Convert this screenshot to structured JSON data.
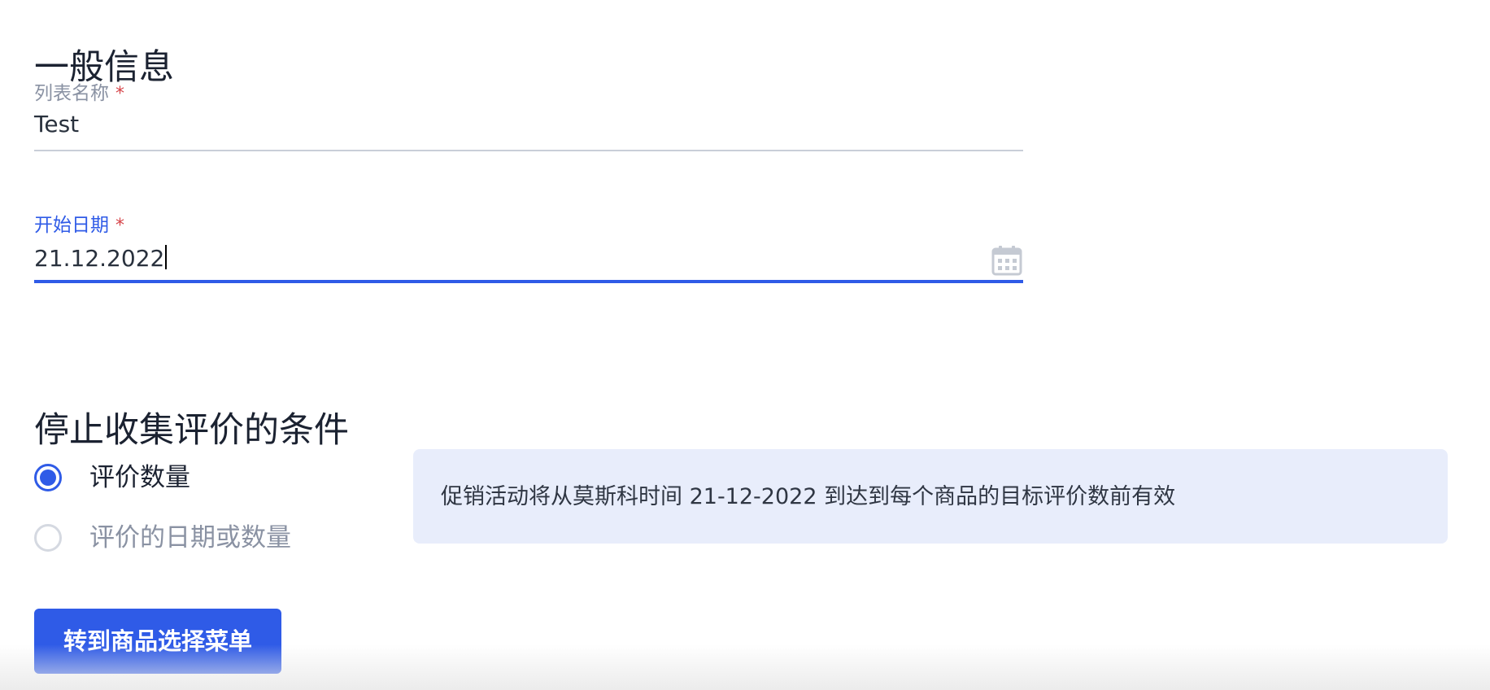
{
  "general": {
    "title": "一般信息"
  },
  "fields": {
    "list_name": {
      "label": "列表名称",
      "required_mark": "*",
      "value": "Test"
    },
    "start_date": {
      "label": "开始日期",
      "required_mark": "*",
      "value": "21.12.2022",
      "icon": "calendar-icon"
    }
  },
  "stop_conditions": {
    "title": "停止收集评价的条件",
    "options": [
      {
        "label": "评价数量",
        "selected": true
      },
      {
        "label": "评价的日期或数量",
        "selected": false
      }
    ],
    "info": "促销活动将从莫斯科时间 21-12-2022 到达到每个商品的目标评价数前有效"
  },
  "actions": {
    "next_label": "转到商品选择菜单"
  },
  "colors": {
    "accent": "#2f5be7",
    "required": "#d6454a",
    "info_background": "#e8edfb",
    "muted_text": "#8a92a3"
  }
}
